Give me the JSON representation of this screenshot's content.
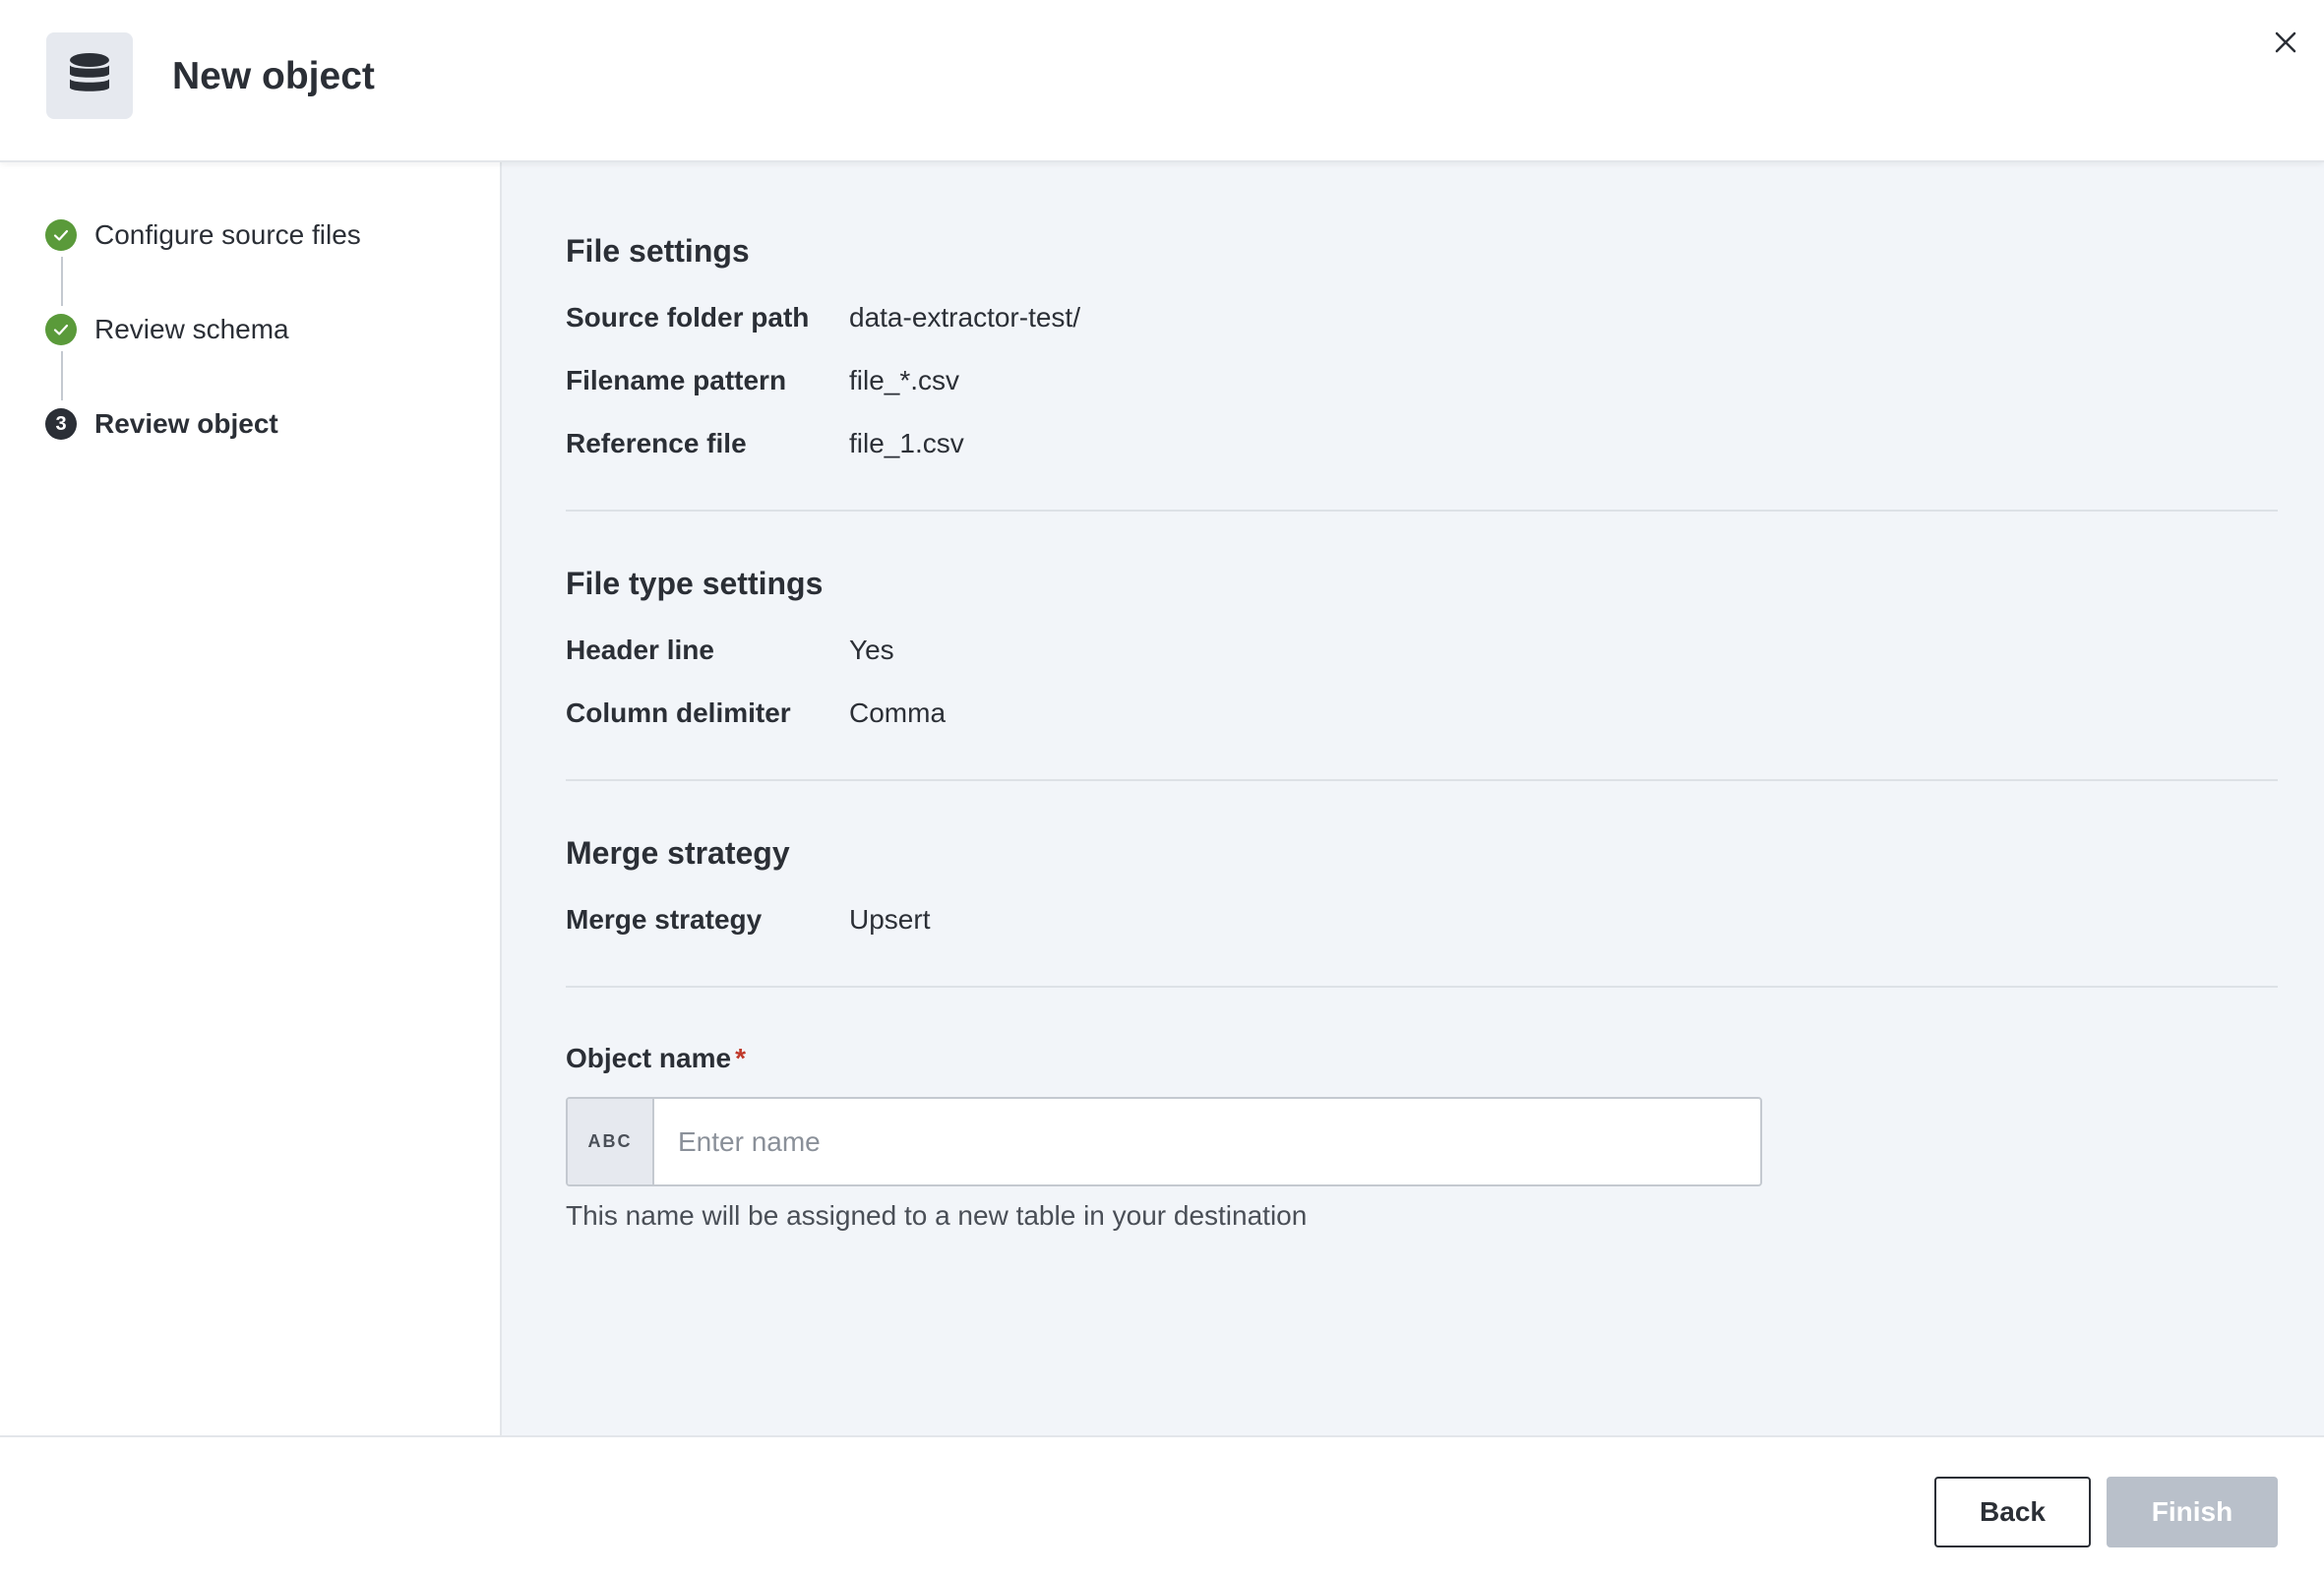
{
  "header": {
    "title": "New object",
    "icon": "database-icon"
  },
  "steps": [
    {
      "label": "Configure source files",
      "status": "completed"
    },
    {
      "label": "Review schema",
      "status": "completed"
    },
    {
      "label": "Review object",
      "status": "current",
      "number": "3"
    }
  ],
  "file_settings": {
    "title": "File settings",
    "rows": [
      {
        "label": "Source folder path",
        "value": "data-extractor-test/"
      },
      {
        "label": "Filename pattern",
        "value": "file_*.csv"
      },
      {
        "label": "Reference file",
        "value": "file_1.csv"
      }
    ]
  },
  "file_type_settings": {
    "title": "File type settings",
    "rows": [
      {
        "label": "Header line",
        "value": "Yes"
      },
      {
        "label": "Column delimiter",
        "value": "Comma"
      }
    ]
  },
  "merge_strategy": {
    "title": "Merge strategy",
    "rows": [
      {
        "label": "Merge strategy",
        "value": "Upsert"
      }
    ]
  },
  "object_name": {
    "label": "Object name",
    "required_marker": "*",
    "prefix": "ABC",
    "value": "",
    "placeholder": "Enter name",
    "helper": "This name will be assigned to a new table in your destination"
  },
  "footer": {
    "back_label": "Back",
    "finish_label": "Finish"
  },
  "colors": {
    "completed": "#5a9a3a",
    "required": "#c0392b",
    "finish_disabled": "#b9c0ca"
  }
}
